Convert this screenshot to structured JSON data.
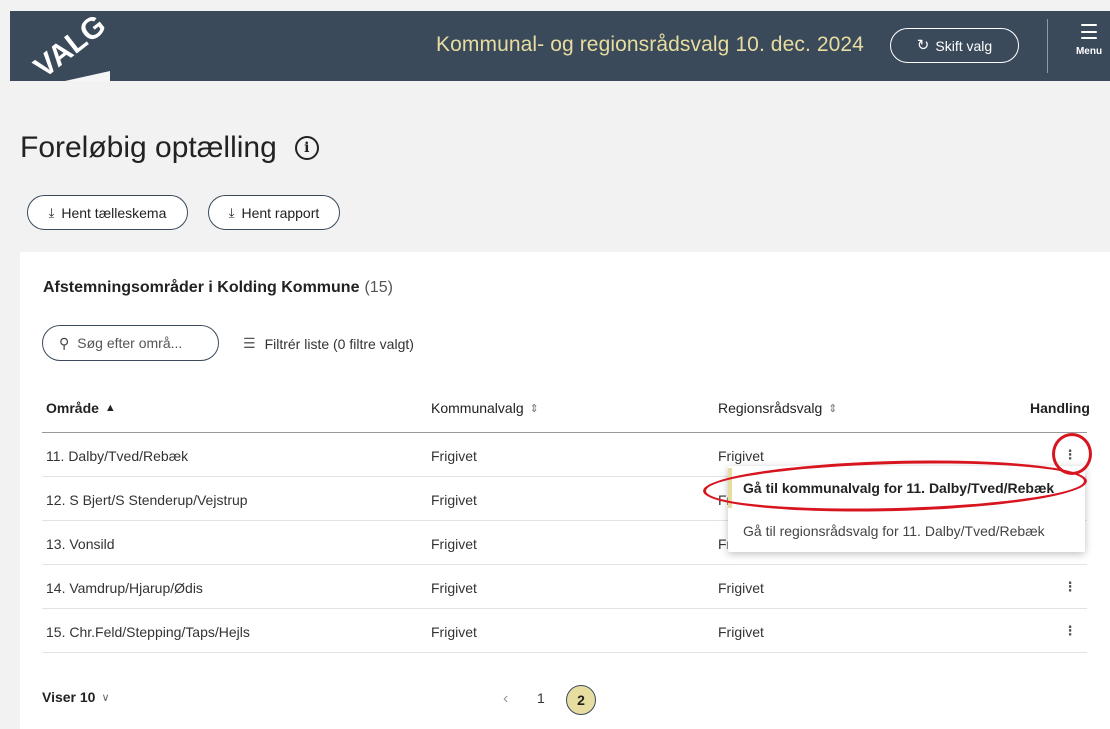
{
  "header": {
    "logo_text": "VALG",
    "election_title": "Kommunal- og regionsrådsvalg 10. dec. 2024",
    "switch_label": "Skift valg",
    "switch_icon": "refresh-icon",
    "menu_label": "Menu",
    "background": "#3b4a5a",
    "accent": "#e7dda0"
  },
  "page": {
    "title": "Foreløbig optælling",
    "info_icon": "i",
    "buttons": {
      "count_sheet": "Hent tælleskema",
      "report": "Hent rapport"
    }
  },
  "card": {
    "title": "Afstemningsområder i Kolding Kommune",
    "count": "(15)",
    "search_placeholder": "Søg efter områ...",
    "filter_label": "Filtrér liste (0 filtre valgt)"
  },
  "table": {
    "columns": [
      "Område",
      "Kommunalvalg",
      "Regionsrådsvalg",
      "Handling"
    ],
    "rows": [
      {
        "area": "11. Dalby/Tved/Rebæk",
        "municipal": "Frigivet",
        "regional": "Frigivet"
      },
      {
        "area": "12. S Bjert/S Stenderup/Vejstrup",
        "municipal": "Frigivet",
        "regional": "Frigivet"
      },
      {
        "area": "13. Vonsild",
        "municipal": "Frigivet",
        "regional": "Frigivet"
      },
      {
        "area": "14. Vamdrup/Hjarup/Ødis",
        "municipal": "Frigivet",
        "regional": "Frigivet"
      },
      {
        "area": "15. Chr.Feld/Stepping/Taps/Hejls",
        "municipal": "Frigivet",
        "regional": "Frigivet"
      }
    ]
  },
  "dropdown": {
    "items": [
      "Gå til kommunalvalg for 11. Dalby/Tved/Rebæk",
      "Gå til regionsrådsvalg for 11. Dalby/Tved/Rebæk"
    ]
  },
  "footer": {
    "shows_label": "Viser 10",
    "pages": [
      "1",
      "2"
    ],
    "current_page": "2"
  }
}
